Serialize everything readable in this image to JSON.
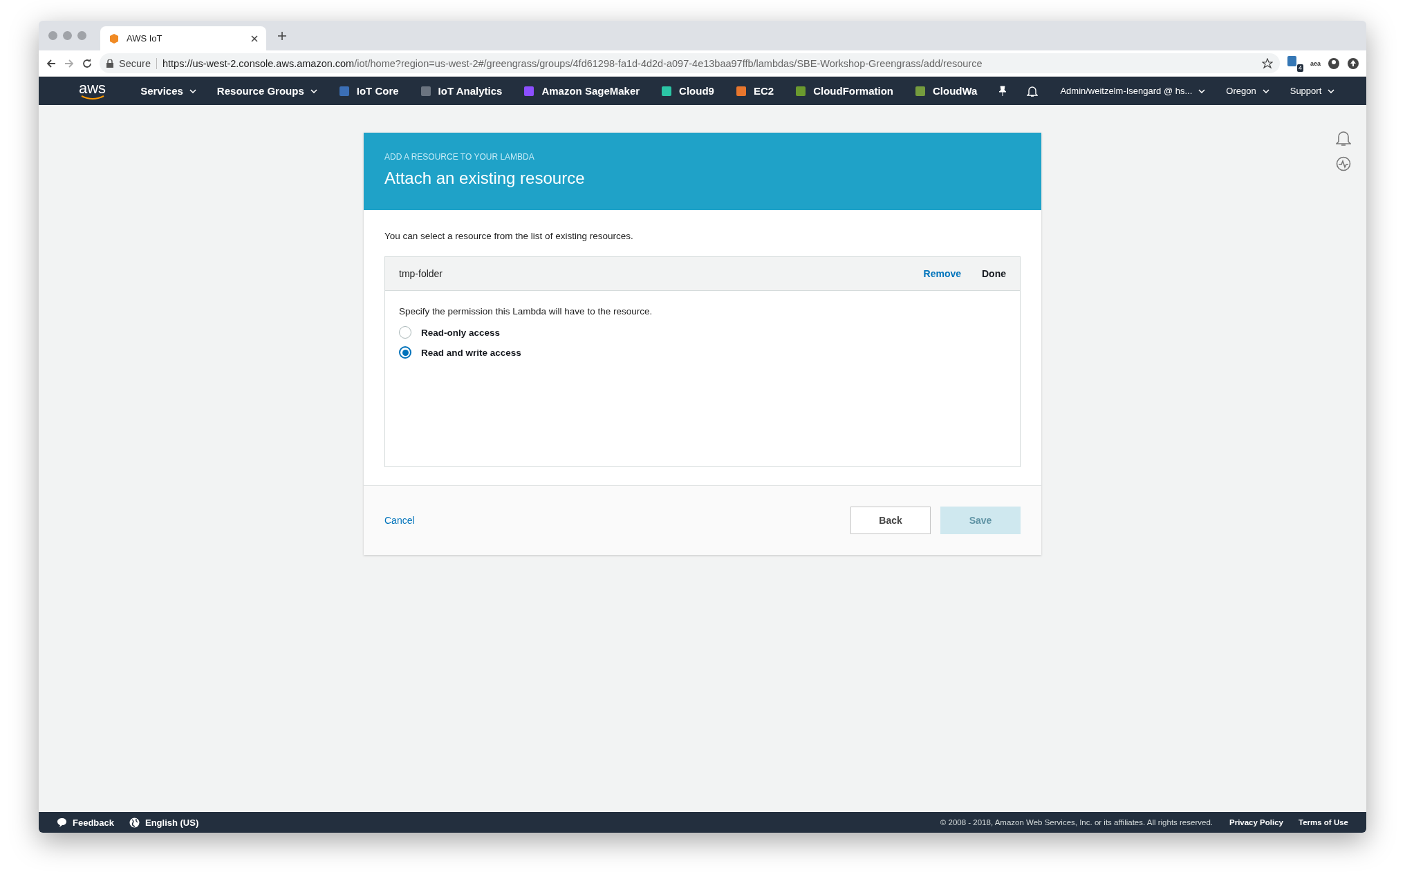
{
  "browser": {
    "tab": {
      "title": "AWS IoT"
    },
    "url": {
      "secure_label": "Secure",
      "host": "https://us-west-2.console.aws.amazon.com",
      "path": "/iot/home?region=us-west-2#/greengrass/groups/4fd61298-fa1d-4d2d-a097-4e13baa97ffb/lambdas/SBE-Workshop-Greengrass/add/resource"
    },
    "extension_badge": "4",
    "extension_label": "aea"
  },
  "nav": {
    "logo": "aws",
    "items": [
      {
        "kind": "menu",
        "label": "Services"
      },
      {
        "kind": "menu",
        "label": "Resource Groups"
      },
      {
        "kind": "service",
        "label": "IoT Core",
        "color": "#3b6fb6"
      },
      {
        "kind": "service",
        "label": "IoT Analytics",
        "color": "#6b7480"
      },
      {
        "kind": "service",
        "label": "Amazon SageMaker",
        "color": "#8c4fff"
      },
      {
        "kind": "service",
        "label": "Cloud9",
        "color": "#2bc5a5"
      },
      {
        "kind": "service",
        "label": "EC2",
        "color": "#e8762d"
      },
      {
        "kind": "service",
        "label": "CloudFormation",
        "color": "#6b9a2e"
      },
      {
        "kind": "service",
        "label": "CloudWa",
        "color": "#759c3e"
      }
    ],
    "account": "Admin/weitzelm-Isengard @ hs...",
    "region": "Oregon",
    "support": "Support"
  },
  "card": {
    "eyebrow": "ADD A RESOURCE TO YOUR LAMBDA",
    "title": "Attach an existing resource",
    "intro": "You can select a resource from the list of existing resources.",
    "resource": {
      "name": "tmp-folder",
      "actions": [
        "Remove",
        "Done"
      ],
      "prompt": "Specify the permission this Lambda will have to the resource.",
      "options": [
        {
          "label": "Read-only access",
          "selected": false
        },
        {
          "label": "Read and write access",
          "selected": true
        }
      ]
    },
    "cancel": "Cancel",
    "buttons": [
      {
        "label": "Back",
        "kind": "secondary",
        "disabled": false
      },
      {
        "label": "Save",
        "kind": "primary",
        "disabled": true
      }
    ]
  },
  "footer": {
    "feedback": "Feedback",
    "language": "English (US)",
    "copyright": "© 2008 - 2018, Amazon Web Services, Inc. or its affiliates. All rights reserved.",
    "links": [
      "Privacy Policy",
      "Terms of Use"
    ]
  }
}
